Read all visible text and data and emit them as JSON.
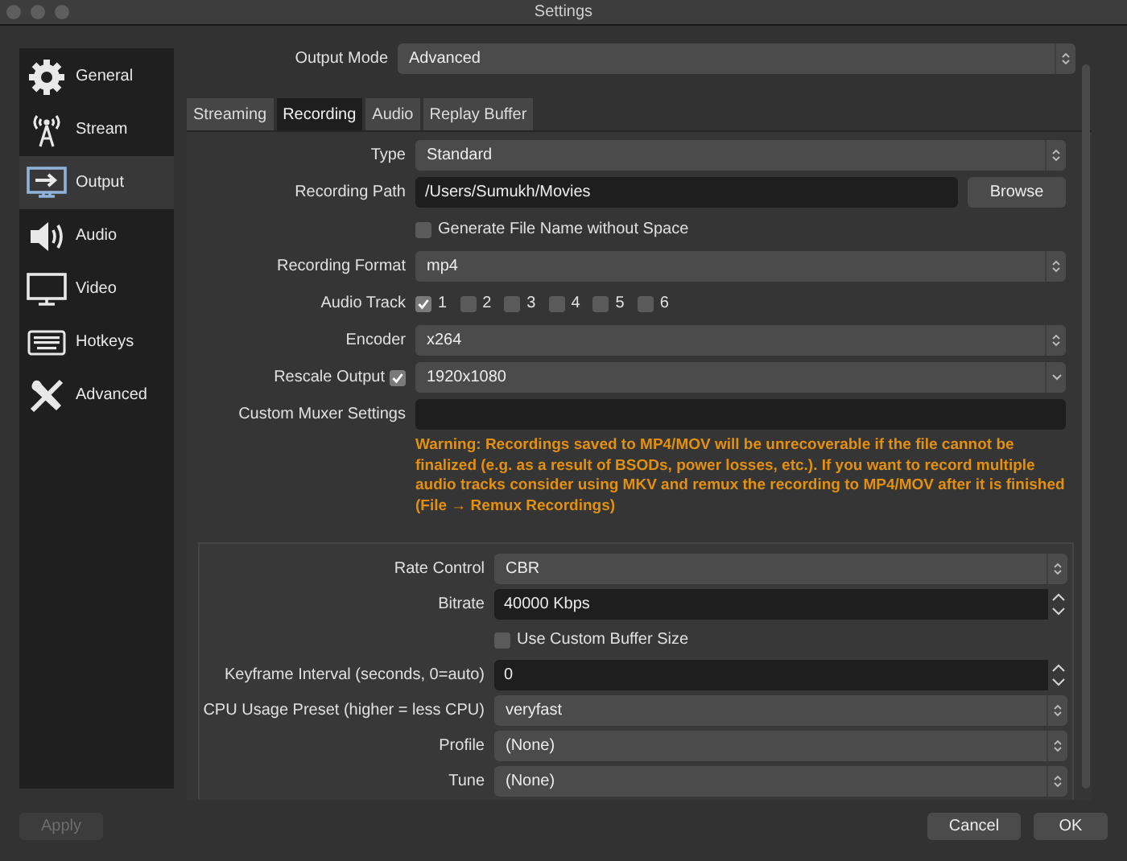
{
  "window": {
    "title": "Settings"
  },
  "sidebar": {
    "items": [
      {
        "label": "General",
        "selected": false
      },
      {
        "label": "Stream",
        "selected": false
      },
      {
        "label": "Output",
        "selected": true
      },
      {
        "label": "Audio",
        "selected": false
      },
      {
        "label": "Video",
        "selected": false
      },
      {
        "label": "Hotkeys",
        "selected": false
      },
      {
        "label": "Advanced",
        "selected": false
      }
    ]
  },
  "output_mode": {
    "label": "Output Mode",
    "value": "Advanced"
  },
  "tabs": [
    {
      "label": "Streaming",
      "selected": false
    },
    {
      "label": "Recording",
      "selected": true
    },
    {
      "label": "Audio",
      "selected": false
    },
    {
      "label": "Replay Buffer",
      "selected": false
    }
  ],
  "recording": {
    "rows": [
      {
        "kind": "select",
        "label": "Type",
        "value": "Standard"
      },
      {
        "kind": "path",
        "label": "Recording Path",
        "value": "/Users/Sumukh/Movies",
        "button": "Browse"
      },
      {
        "kind": "checkbox",
        "label": "Generate File Name without Space",
        "checked": false
      },
      {
        "kind": "select",
        "label": "Recording Format",
        "value": "mp4"
      },
      {
        "kind": "tracks",
        "label": "Audio Track",
        "tracks": [
          {
            "label": "1",
            "checked": true
          },
          {
            "label": "2",
            "checked": false
          },
          {
            "label": "3",
            "checked": false
          },
          {
            "label": "4",
            "checked": false
          },
          {
            "label": "5",
            "checked": false
          },
          {
            "label": "6",
            "checked": false
          }
        ]
      },
      {
        "kind": "select",
        "label": "Encoder",
        "value": "x264"
      },
      {
        "kind": "combo",
        "label": "Rescale Output",
        "checked": true,
        "value": "1920x1080"
      },
      {
        "kind": "text",
        "label": "Custom Muxer Settings"
      }
    ],
    "warning": "Warning: Recordings saved to MP4/MOV will be unrecoverable if the file cannot be finalized (e.g. as a result of BSODs, power losses, etc.). If you want to record multiple audio tracks consider using MKV and remux the recording to MP4/MOV after it is finished (File → Remux Recordings)"
  },
  "encoder_settings": {
    "rows": [
      {
        "kind": "select",
        "label": "Rate Control",
        "value": "CBR"
      },
      {
        "kind": "spin",
        "label": "Bitrate",
        "value": "40000 Kbps"
      },
      {
        "kind": "checkbox",
        "label": "Use Custom Buffer Size",
        "checked": false
      },
      {
        "kind": "spin",
        "label": "Keyframe Interval (seconds, 0=auto)",
        "value": "0"
      },
      {
        "kind": "select",
        "label": "CPU Usage Preset (higher = less CPU)",
        "value": "veryfast"
      },
      {
        "kind": "select",
        "label": "Profile",
        "value": "(None)"
      },
      {
        "kind": "select",
        "label": "Tune",
        "value": "(None)"
      }
    ]
  },
  "buttons": [
    {
      "label": "Apply",
      "disabled": true
    },
    {
      "label": "Cancel",
      "disabled": false
    },
    {
      "label": "OK",
      "disabled": false
    }
  ]
}
